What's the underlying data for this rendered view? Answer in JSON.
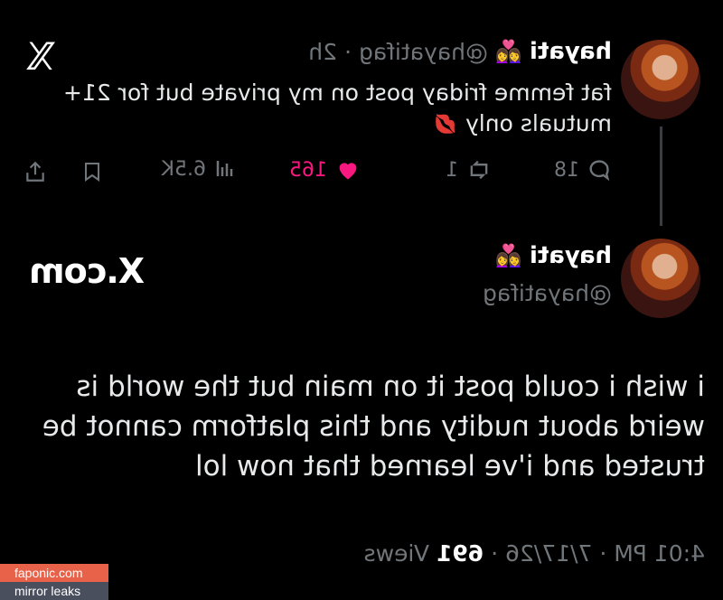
{
  "first_tweet": {
    "display_name": "hayati",
    "name_emoji": "👩‍❤️‍👩",
    "handle": "@hayatifag",
    "separator": "·",
    "time_ago": "2h",
    "text_line1": "fat femme friday post on my private but for 21+",
    "text_line2": "mutuals only",
    "text_emoji": "💋",
    "actions": {
      "replies": "18",
      "reposts": "1",
      "likes": "165",
      "views": "6.5K"
    },
    "like_color": "#f91880"
  },
  "second_tweet": {
    "display_name": "hayati",
    "name_emoji": "👩‍❤️‍👩",
    "handle": "@hayatifag",
    "text_line1": "i wish i could post it on main but the world is",
    "text_line2": "weird about nudity and this platform cannot be",
    "text_line3": "trusted and i've learned that now lol",
    "meta_time": "4:01 PM · 7/17/26 ·",
    "meta_views_count": "691",
    "meta_views_label": "Views"
  },
  "brand": {
    "logo_glyph": "𝕏",
    "wordmark": "X.com"
  },
  "watermark": {
    "site": "faponic.com",
    "tagline": "mirror leaks",
    "site_bg": "#e8624a",
    "tagline_bg": "#4a4f5e"
  }
}
